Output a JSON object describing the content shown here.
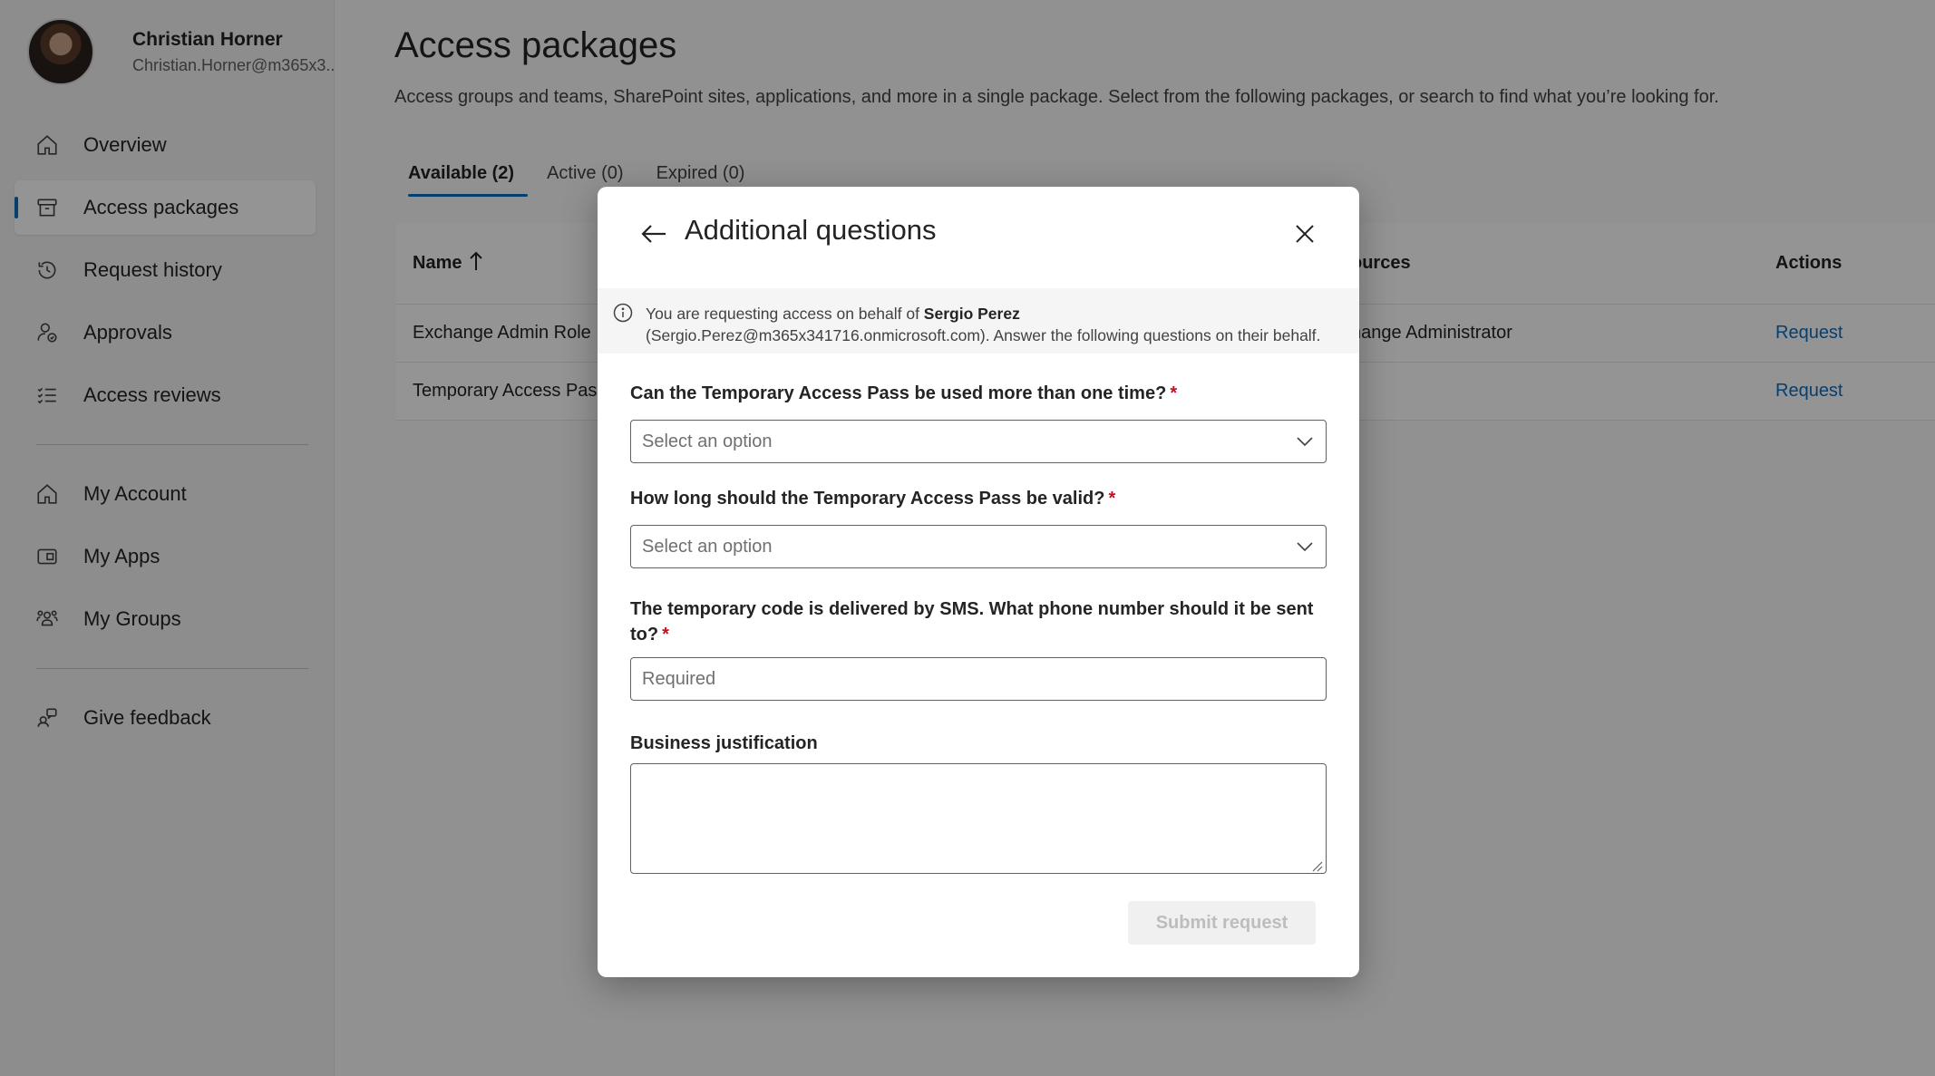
{
  "user": {
    "name": "Christian Horner",
    "email": "Christian.Horner@m365x3..."
  },
  "sidebar": {
    "items": [
      {
        "label": "Overview",
        "icon": "home-icon"
      },
      {
        "label": "Access packages",
        "icon": "package-icon",
        "active": true
      },
      {
        "label": "Request history",
        "icon": "history-icon"
      },
      {
        "label": "Approvals",
        "icon": "approvals-icon"
      },
      {
        "label": "Access reviews",
        "icon": "checklist-icon"
      }
    ],
    "secondary_items": [
      {
        "label": "My Account",
        "icon": "home-icon"
      },
      {
        "label": "My Apps",
        "icon": "apps-icon"
      },
      {
        "label": "My Groups",
        "icon": "groups-icon"
      }
    ],
    "feedback": {
      "label": "Give feedback",
      "icon": "feedback-icon"
    }
  },
  "main": {
    "title": "Access packages",
    "description": "Access groups and teams, SharePoint sites, applications, and more in a single package. Select from the following packages, or search to find what you’re looking for.",
    "tabs": [
      {
        "label": "Available (2)",
        "active": true
      },
      {
        "label": "Active (0)"
      },
      {
        "label": "Expired (0)"
      }
    ],
    "table": {
      "headers": {
        "name": "Name",
        "resources": "ources",
        "actions": "Actions"
      },
      "rows": [
        {
          "name": "Exchange Admin Role",
          "resources": "hange Administrator",
          "action": "Request"
        },
        {
          "name": "Temporary Access Pass",
          "resources": "",
          "action": "Request"
        }
      ]
    }
  },
  "dialog": {
    "title": "Additional questions",
    "info": {
      "prefix": "You are requesting access on behalf of ",
      "name": "Sergio Perez",
      "suffix": "(Sergio.Perez@m365x341716.onmicrosoft.com). Answer the following questions on their behalf."
    },
    "questions": [
      {
        "label": "Can the Temporary Access Pass be used more than one time?",
        "required": "*",
        "type": "select",
        "value": "Select an option"
      },
      {
        "label": "How long should the Temporary Access Pass be valid?",
        "required": "*",
        "type": "select",
        "value": "Select an option"
      },
      {
        "label": "The temporary code is delivered by SMS. What phone number should it be sent to?",
        "required": "*",
        "type": "text",
        "placeholder": "Required"
      }
    ],
    "justification_label": "Business justification",
    "submit_label": "Submit request"
  },
  "colors": {
    "accent": "#0f6cbd",
    "required": "#c50f1f",
    "overlay": "rgba(0,0,0,0.42)"
  }
}
